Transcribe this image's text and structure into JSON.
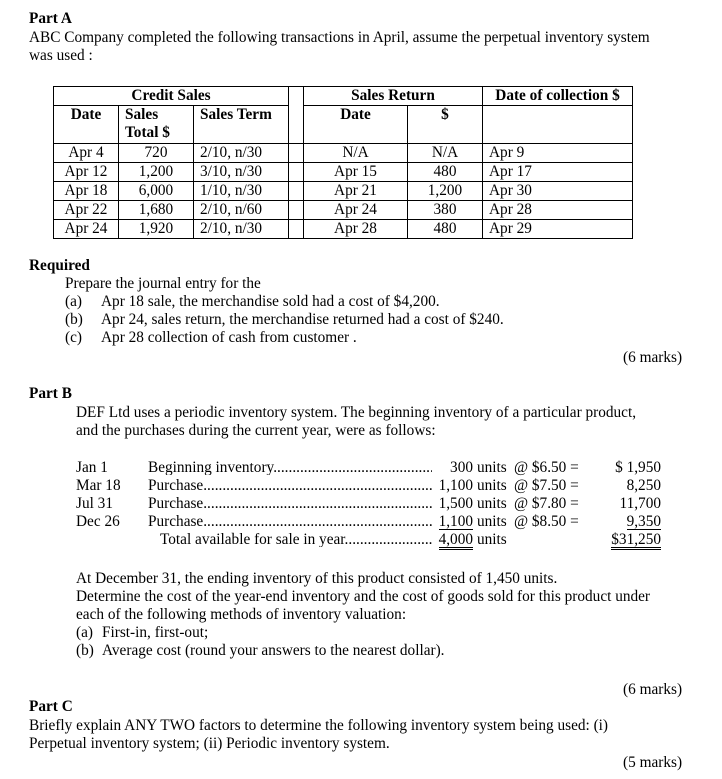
{
  "part_a": {
    "heading": "Part A",
    "intro_line1": "ABC Company completed the following transactions in April, assume the perpetual inventory system",
    "intro_line2": "was used :",
    "table": {
      "group_headers": {
        "credit_sales": "Credit Sales",
        "sales_return": "Sales Return",
        "date_of_collection": "Date of collection $"
      },
      "columns": {
        "date": "Date",
        "sales_total_line1": "Sales",
        "sales_total_line2": "Total $",
        "sales_term": "Sales Term",
        "return_date": "Date",
        "return_amount": "$"
      },
      "rows": [
        {
          "date": "Apr 4",
          "sales_total": "720",
          "sales_term": "2/10, n/30",
          "return_date": "N/A",
          "return_amount": "N/A",
          "collection_date": "Apr 9"
        },
        {
          "date": "Apr 12",
          "sales_total": "1,200",
          "sales_term": "3/10, n/30",
          "return_date": "Apr 15",
          "return_amount": "480",
          "collection_date": "Apr 17"
        },
        {
          "date": "Apr 18",
          "sales_total": "6,000",
          "sales_term": "1/10, n/30",
          "return_date": "Apr 21",
          "return_amount": "1,200",
          "collection_date": "Apr 30"
        },
        {
          "date": "Apr 22",
          "sales_total": "1,680",
          "sales_term": "2/10, n/60",
          "return_date": "Apr 24",
          "return_amount": "380",
          "collection_date": "Apr 28"
        },
        {
          "date": "Apr 24",
          "sales_total": "1,920",
          "sales_term": "2/10, n/30",
          "return_date": "Apr 28",
          "return_amount": "480",
          "collection_date": "Apr 29"
        }
      ]
    },
    "required": {
      "heading": "Required",
      "prompt": "Prepare the journal entry for the",
      "items": [
        {
          "label": "(a)",
          "text": "Apr 18 sale, the merchandise sold had a cost of $4,200."
        },
        {
          "label": "(b)",
          "text": "Apr 24, sales return, the merchandise returned had a cost of $240."
        },
        {
          "label": "(c)",
          "text": "Apr 28 collection of cash from customer ."
        }
      ],
      "marks": "(6 marks)"
    }
  },
  "part_b": {
    "heading": "Part B",
    "intro_line1": "DEF Ltd uses a periodic inventory system.  The beginning inventory of a particular product,",
    "intro_line2": "and the purchases during the current year, were as follows:",
    "inventory": [
      {
        "date": "Jan 1",
        "label": "Beginning inventory",
        "units": "300",
        "units_suffix": "units",
        "at": "@ $6.50 =",
        "cost": "$ 1,950"
      },
      {
        "date": "Mar 18",
        "label": "Purchase",
        "units": "1,100",
        "units_suffix": "units",
        "at": "@ $7.50 =",
        "cost": "8,250"
      },
      {
        "date": "Jul 31",
        "label": "Purchase",
        "units": "1,500",
        "units_suffix": "units",
        "at": "@ $7.80 =",
        "cost": "11,700"
      },
      {
        "date": "Dec 26",
        "label": "Purchase",
        "units": "1,100",
        "units_suffix": "units",
        "at": "@ $8.50 =",
        "cost": "9,350"
      }
    ],
    "total": {
      "label": "Total available for sale in year",
      "units": "4,000",
      "units_suffix": "units",
      "cost": "$31,250"
    },
    "body_line1": "At December 31, the ending inventory of this product consisted of 1,450 units.",
    "body_line2": "Determine the cost of the year-end inventory and the cost of goods sold for this product under",
    "body_line3": "each of the following methods of inventory valuation:",
    "items": [
      {
        "label": "(a)",
        "text": "First-in, first-out;"
      },
      {
        "label": "(b)",
        "text": "Average cost (round your answers to the nearest dollar)."
      }
    ],
    "marks": "(6 marks)"
  },
  "part_c": {
    "heading": "Part C",
    "line1": "Briefly explain ANY TWO factors to determine the following inventory system being used: (i)",
    "line2": "Perpetual inventory system; (ii) Periodic inventory system.",
    "marks": "(5 marks)"
  }
}
